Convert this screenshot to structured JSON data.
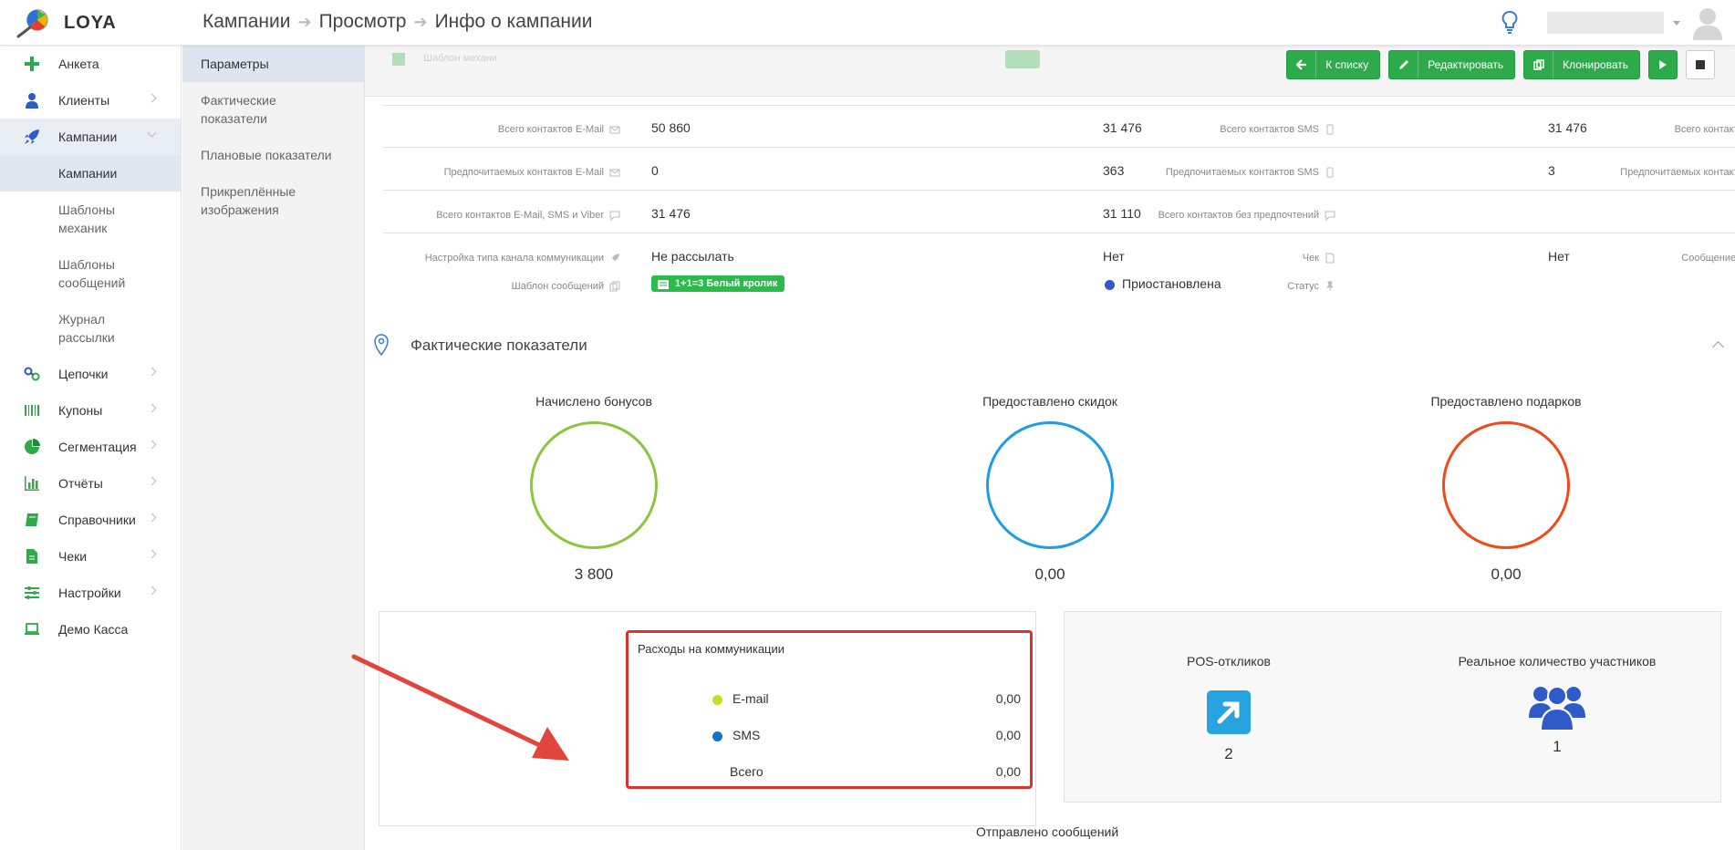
{
  "app": {
    "logo_text": "LOYA"
  },
  "breadcrumb": [
    "Кампании",
    "Просмотр",
    "Инфо о кампании"
  ],
  "sidebar": {
    "items": [
      {
        "label": "Анкета",
        "icon": "plus-icon"
      },
      {
        "label": "Клиенты",
        "icon": "user-icon"
      },
      {
        "label": "Кампании",
        "icon": "rocket-icon"
      },
      {
        "label": "Цепочки",
        "icon": "chain-icon"
      },
      {
        "label": "Купоны",
        "icon": "barcode-icon"
      },
      {
        "label": "Сегментация",
        "icon": "pie-icon"
      },
      {
        "label": "Отчёты",
        "icon": "bar-chart-icon"
      },
      {
        "label": "Справочники",
        "icon": "book-icon"
      },
      {
        "label": "Чеки",
        "icon": "receipt-icon"
      },
      {
        "label": "Настройки",
        "icon": "sliders-icon"
      },
      {
        "label": "Демо Касса",
        "icon": "laptop-icon"
      }
    ],
    "campaigns_sub": [
      "Кампании",
      "Шаблоны механик",
      "Шаблоны сообщений",
      "Журнал рассылки"
    ]
  },
  "subnav": [
    "Параметры",
    "Фактические показатели",
    "Плановые показатели",
    "Прикреплённые изображения"
  ],
  "toolbar": {
    "faded_text": "Шаблон механи",
    "back_label": "К списку",
    "edit_label": "Редактировать",
    "clone_label": "Клонировать"
  },
  "info": {
    "total_email_label": "Всего контактов E-Mail",
    "total_email": "50 860",
    "total_sms_label": "Всего контактов SMS",
    "total_sms": "31 476",
    "total_viber_label": "Всего контактов Viber",
    "total_viber": "31 476",
    "pref_email_label": "Предпочитаемых контактов E-Mail",
    "pref_email": "0",
    "pref_sms_label": "Предпочитаемых контактов SMS",
    "pref_sms": "363",
    "pref_viber_label": "Предпочитаемых контактов Viber",
    "pref_viber": "3",
    "total_all_label": "Всего контактов E-Mail, SMS и Viber",
    "total_all": "31 476",
    "total_nopref_label": "Всего контактов без предпочтений",
    "total_nopref": "31 110",
    "channel_label": "Настройка типа канала коммуникации",
    "channel": "Не рассылать",
    "check_label": "Чек",
    "check": "Нет",
    "cashier_label": "Сообщение кассиру",
    "cashier": "Нет",
    "template_label": "Шаблон сообщений",
    "template": "1+1=3 Белый кролик",
    "status_label": "Статус",
    "status": "Приостановлена"
  },
  "facts": {
    "title": "Фактические показатели",
    "metrics": [
      {
        "title": "Начислено бонусов",
        "value": "3 800",
        "color": "#8cc63f"
      },
      {
        "title": "Предоставлено скидок",
        "value": "0,00",
        "color": "#1e9be9"
      },
      {
        "title": "Предоставлено подарков",
        "value": "0,00",
        "color": "#f04a1a"
      }
    ],
    "costs": {
      "title": "Расходы на коммуникации",
      "rows": [
        {
          "name": "E-mail",
          "value": "0,00",
          "color": "#c8dc2a"
        },
        {
          "name": "SMS",
          "value": "0,00",
          "color": "#1b6fc4"
        },
        {
          "name": "Всего",
          "value": "0,00",
          "color": ""
        }
      ]
    },
    "pos_title": "POS-откликов",
    "pos_value": "2",
    "participants_title": "Реальное количество участников",
    "participants_value": "1",
    "sent_title": "Отправлено сообщений"
  },
  "colors": {
    "accent_green": "#2daa4a",
    "highlight_red": "#d9342b",
    "status_blue": "#2e5bc7"
  }
}
